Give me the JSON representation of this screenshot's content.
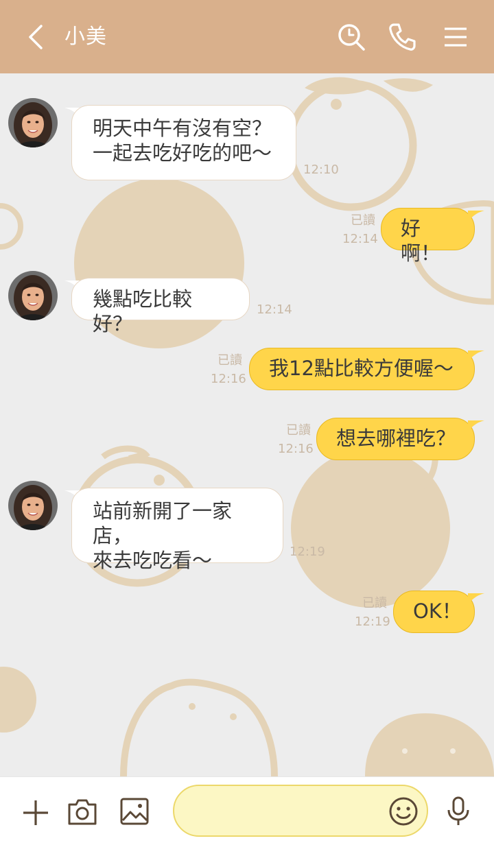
{
  "header": {
    "title": "小美",
    "back_icon": "chevron-left-icon",
    "search_icon": "search-icon",
    "call_icon": "phone-icon",
    "menu_icon": "menu-icon",
    "background": "#d9b08c"
  },
  "messages": [
    {
      "side": "in",
      "text": "明天中午有沒有空？\n一起去吃好吃的吧～",
      "time": "12:10"
    },
    {
      "side": "out",
      "text": "好啊！",
      "read": "已讀",
      "time": "12:14"
    },
    {
      "side": "in",
      "text": "幾點吃比較好？",
      "time": "12:14"
    },
    {
      "side": "out",
      "text": "我12點比較方便喔～",
      "read": "已讀",
      "time": "12:16"
    },
    {
      "side": "out",
      "text": "想去哪裡吃？",
      "read": "已讀",
      "time": "12:16"
    },
    {
      "side": "in",
      "text": "站前新開了一家店，\n來去吃吃看～",
      "time": "12:19"
    },
    {
      "side": "out",
      "text": "OK！",
      "read": "已讀",
      "time": "12:19"
    }
  ],
  "composer": {
    "placeholder": "",
    "value": "",
    "add_icon": "plus-icon",
    "camera_icon": "camera-icon",
    "image_icon": "image-icon",
    "emoji_icon": "smiley-icon",
    "mic_icon": "microphone-icon"
  },
  "colors": {
    "background": "#ededed",
    "incoming_bubble": "#ffffff",
    "outgoing_bubble": "#ffd54a",
    "meta_text": "#c9b9a6",
    "doodle": "#e4d3b7",
    "icon_dark": "#5a4836"
  }
}
